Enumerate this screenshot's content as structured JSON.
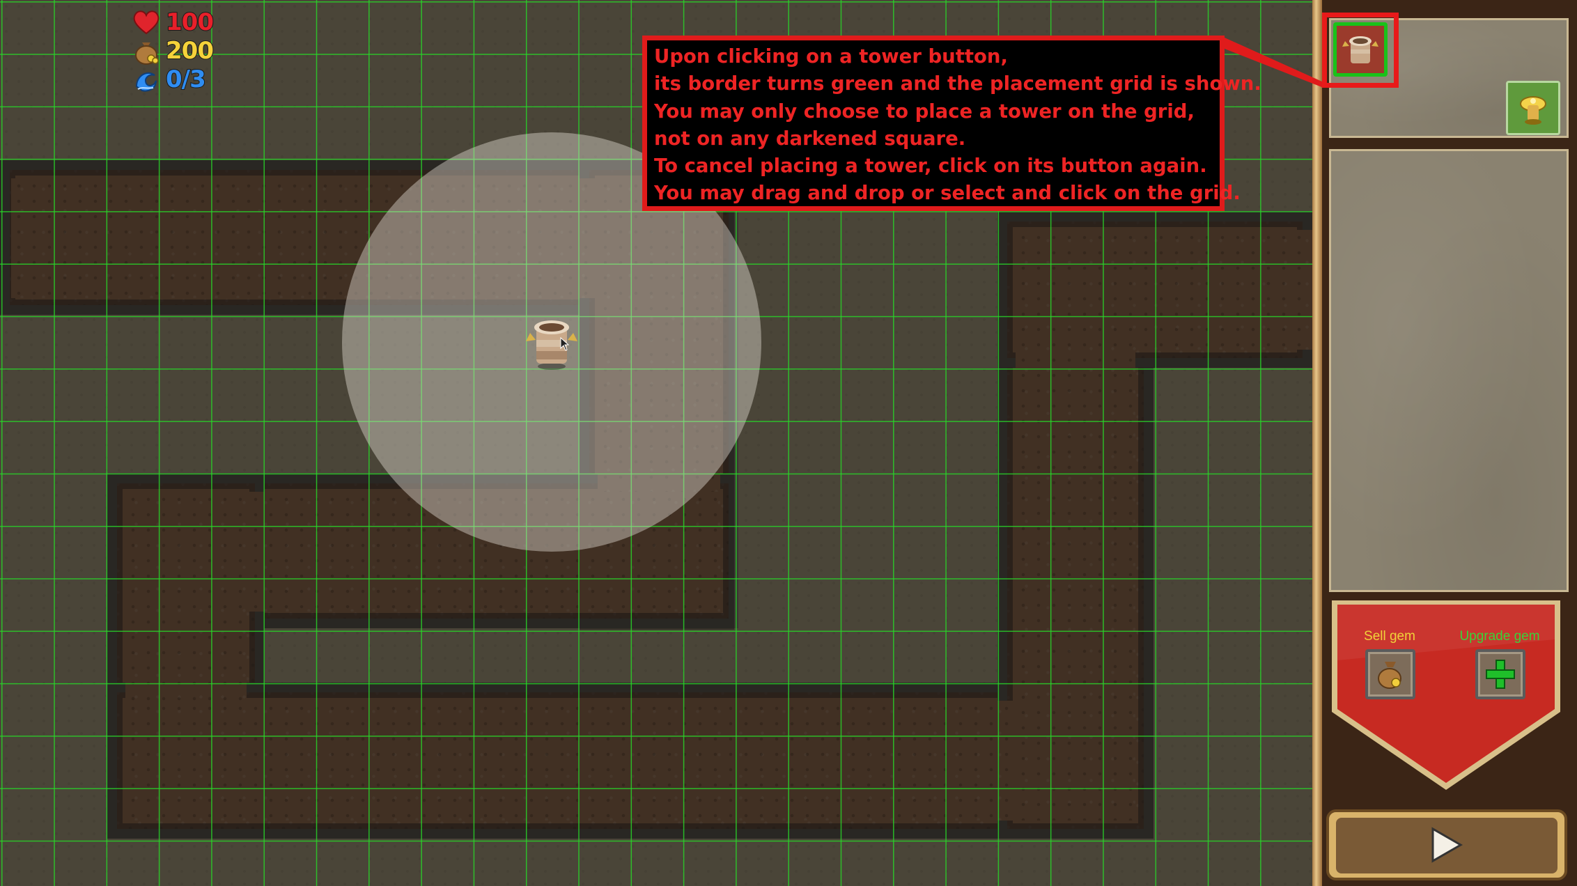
{
  "hud": {
    "lives": "100",
    "gold": "200",
    "wave": "0/3",
    "lives_color": "#e8202a",
    "gold_color": "#f5d23a",
    "wave_color": "#2f8df2",
    "lives_icon": "heart-icon",
    "gold_icon": "money-bag-icon",
    "wave_icon": "wave-icon"
  },
  "tutorial": {
    "lines": [
      "Upon clicking on a tower button,",
      "its border turns green and the placement grid is shown.",
      "You may only choose to place a tower on the grid,",
      "not on any darkened square.",
      "To cancel placing a tower, click on its button again.",
      "You may drag and drop or select and click on the grid."
    ],
    "text_color": "#ee2424",
    "border_color": "#e01b1b"
  },
  "towers": [
    {
      "name": "stone-tower",
      "icon": "stone-tower-icon",
      "state": "selected",
      "border_color": "#19c219"
    },
    {
      "name": "gold-tower",
      "icon": "gold-tower-icon",
      "state": "available"
    }
  ],
  "gem_panel": {
    "sell_label": "Sell gem",
    "upgrade_label": "Upgrade gem",
    "sell_icon": "money-bag-icon",
    "upgrade_icon": "plus-icon",
    "sell_color": "#f0d23a",
    "upgrade_color": "#3ad23a"
  },
  "controls": {
    "play_icon": "play-icon"
  },
  "grid_color": "#28d228",
  "range_color": "#e6e2da"
}
